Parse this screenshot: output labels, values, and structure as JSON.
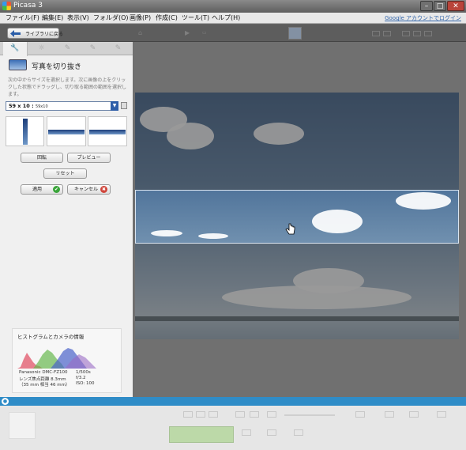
{
  "window": {
    "title": "Picasa 3",
    "close_glyph": "✕",
    "min_glyph": "–",
    "max_glyph": "□"
  },
  "menu": {
    "items": [
      "ファイル(F)",
      "編集(E)",
      "表示(V)",
      "フォルダ(O)",
      "画像(P)",
      "作成(C)",
      "ツール(T)",
      "ヘルプ(H)"
    ],
    "account": "Google アカウントでログイン"
  },
  "toolbar": {
    "back_label": "ライブラリに戻る"
  },
  "panel": {
    "tabs": [
      "🔧",
      "☼",
      "✎",
      "✎",
      "✎"
    ],
    "crop_title": "写真を切り抜き",
    "crop_description": "次の中からサイズを選択します。次に画像の上をクリックした状態でドラッグし、切り取る範囲の範囲を選択します。",
    "size_value": "59 x 10 :",
    "size_value_small": "59x10",
    "dropdown_glyph": "▼",
    "buttons": {
      "rotate": "回転",
      "preview": "プレビュー",
      "reset": "リセット",
      "apply": "適用",
      "cancel": "キャンセル",
      "apply_glyph": "✔",
      "cancel_glyph": "✖"
    }
  },
  "histogram": {
    "title": "ヒストグラムとカメラの情報",
    "camera_model": "Panasonic DMC-FZ100",
    "focal_length": "レンズ焦点距離 8.3mm",
    "equiv_35mm": "（35 mm 相当 46 mm）",
    "shutter": "1/500s",
    "aperture": "f/3.2",
    "iso": "ISO: 100"
  },
  "colors": {
    "accent": "#2f8cc7",
    "apply_icon": "#3aa53a",
    "cancel_icon": "#d0453b",
    "crop_border": "#d9e4f0"
  }
}
